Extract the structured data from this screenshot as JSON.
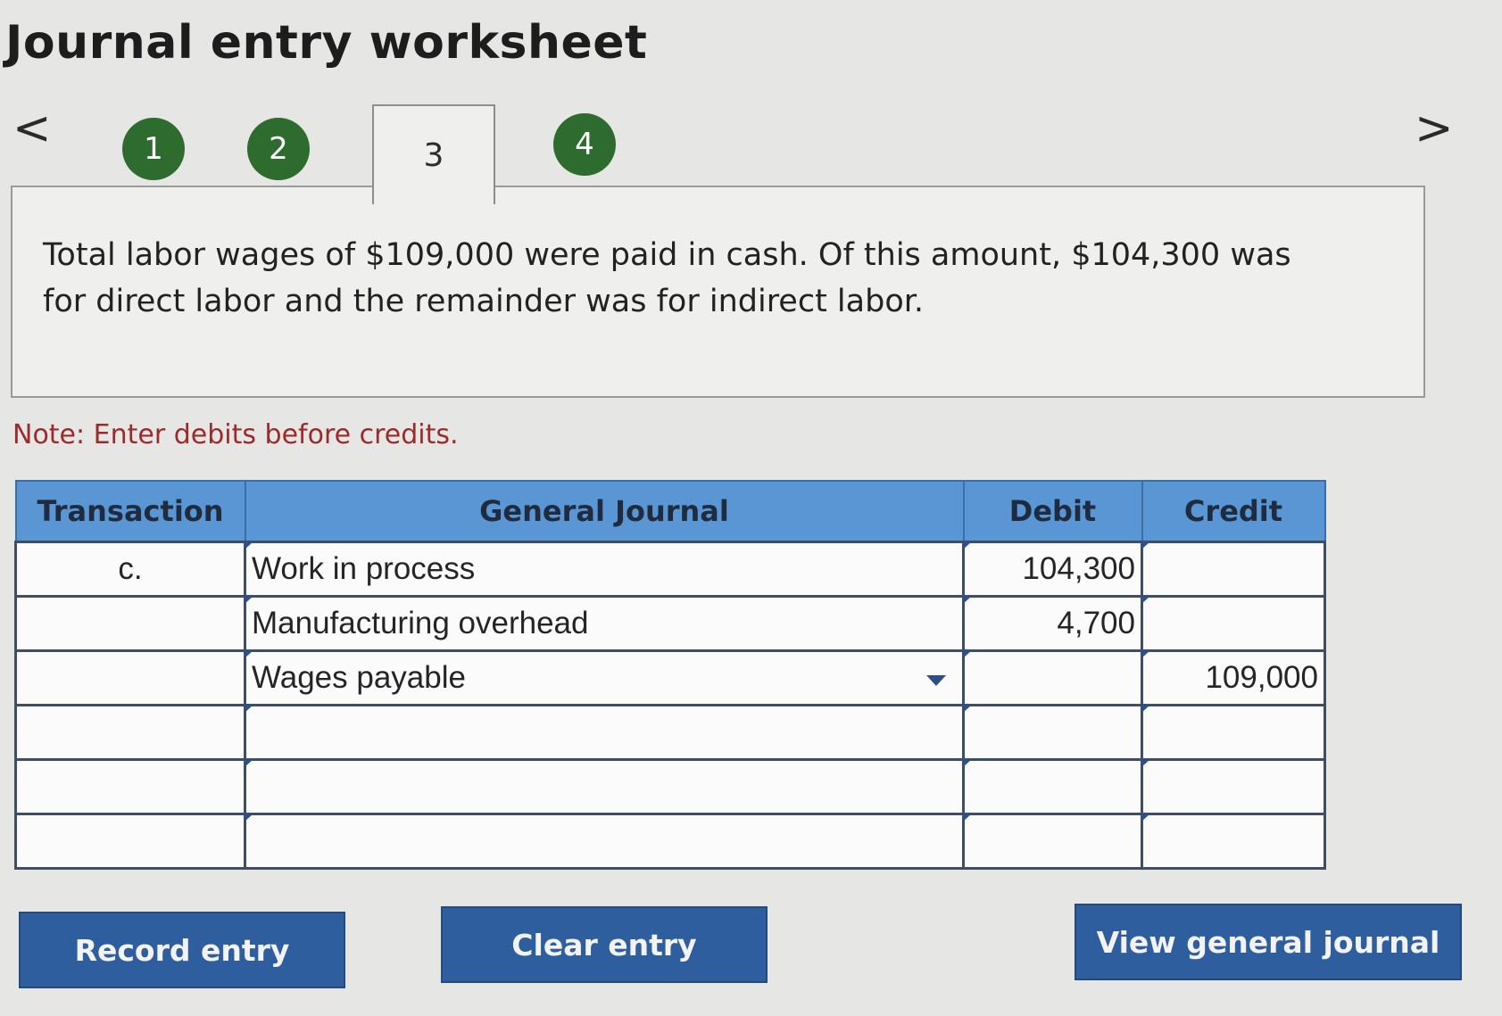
{
  "title": "Journal entry worksheet",
  "nav": {
    "prev_icon": "chevron-left-icon",
    "next_icon": "chevron-right-icon",
    "prev": "<",
    "next": ">"
  },
  "steps": [
    {
      "label": "1",
      "status": "complete"
    },
    {
      "label": "2",
      "status": "complete"
    },
    {
      "label": "3",
      "status": "current"
    },
    {
      "label": "4",
      "status": "complete"
    }
  ],
  "question": "Total labor wages of $109,000 were paid in cash. Of this amount, $104,300 was for direct labor and the remainder was for indirect labor.",
  "note": "Note: Enter debits before credits.",
  "table": {
    "headers": {
      "transaction": "Transaction",
      "general_journal": "General Journal",
      "debit": "Debit",
      "credit": "Credit"
    },
    "rows": [
      {
        "transaction": "c.",
        "account": "Work in process",
        "debit": "104,300",
        "credit": ""
      },
      {
        "transaction": "",
        "account": "Manufacturing overhead",
        "debit": "4,700",
        "credit": ""
      },
      {
        "transaction": "",
        "account": "Wages payable",
        "debit": "",
        "credit": "109,000"
      },
      {
        "transaction": "",
        "account": "",
        "debit": "",
        "credit": ""
      },
      {
        "transaction": "",
        "account": "",
        "debit": "",
        "credit": ""
      },
      {
        "transaction": "",
        "account": "",
        "debit": "",
        "credit": ""
      }
    ]
  },
  "buttons": {
    "record": "Record entry",
    "clear": "Clear entry",
    "view": "View general journal"
  },
  "colors": {
    "step_complete": "#2e6b2e",
    "header_bg": "#5a96d4",
    "button_bg": "#2f5e9e",
    "note": "#9b2b2b"
  }
}
